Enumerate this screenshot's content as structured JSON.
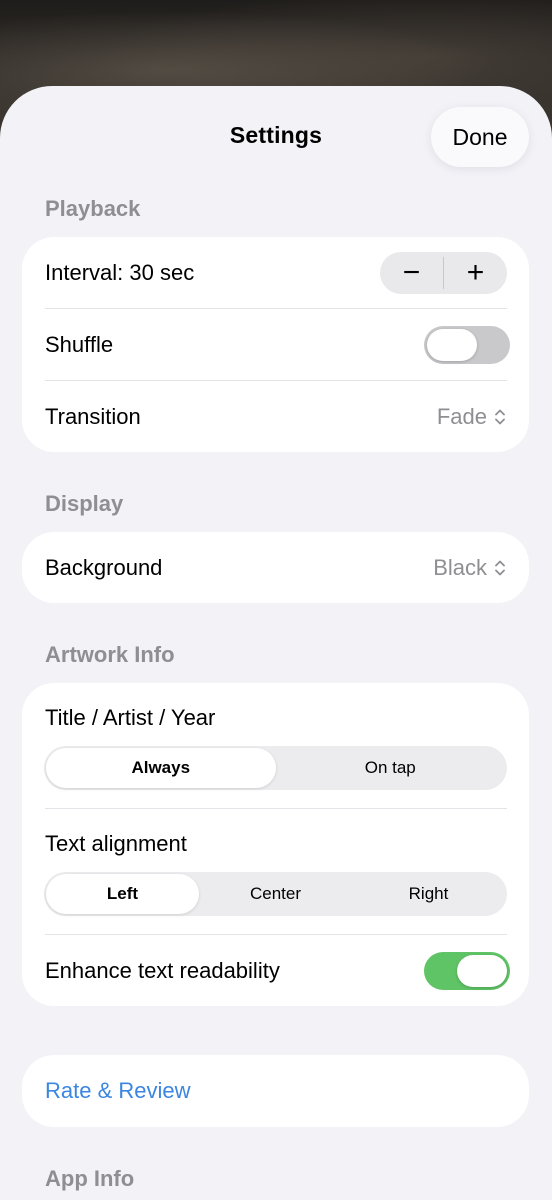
{
  "header": {
    "title": "Settings",
    "done_label": "Done"
  },
  "playback": {
    "section_title": "Playback",
    "interval_label": "Interval: 30 sec",
    "decrement_symbol": "−",
    "increment_symbol": "+",
    "shuffle_label": "Shuffle",
    "shuffle_on": false,
    "transition_label": "Transition",
    "transition_value": "Fade"
  },
  "display": {
    "section_title": "Display",
    "background_label": "Background",
    "background_value": "Black"
  },
  "artwork_info": {
    "section_title": "Artwork Info",
    "title_artist_year_label": "Title / Artist / Year",
    "title_options": [
      "Always",
      "On tap"
    ],
    "title_selected": "Always",
    "text_alignment_label": "Text alignment",
    "alignment_options": [
      "Left",
      "Center",
      "Right"
    ],
    "alignment_selected": "Left",
    "enhance_label": "Enhance text readability",
    "enhance_on": true
  },
  "rate": {
    "label": "Rate & Review"
  },
  "app_info": {
    "section_title": "App Info"
  },
  "colors": {
    "accent_link": "#3a86e0",
    "toggle_on": "#5fc466",
    "toggle_off": "#c9c9cc",
    "sheet_bg": "#f2f2f7"
  },
  "icons": {
    "picker_chevron": "chevron-up-down-icon"
  }
}
